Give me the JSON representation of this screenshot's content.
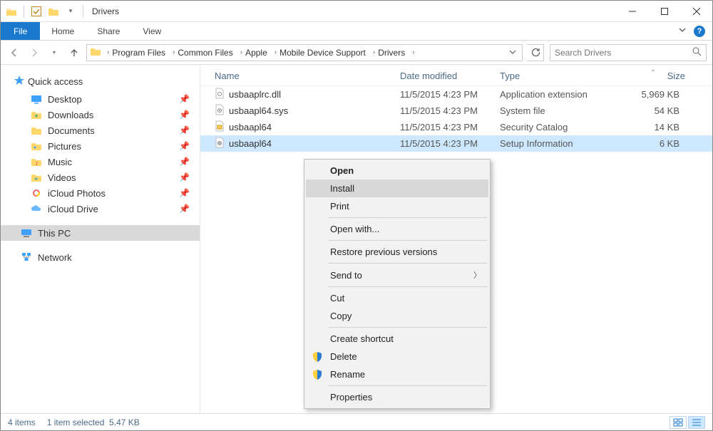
{
  "window": {
    "title": "Drivers"
  },
  "ribbon": {
    "file": "File",
    "tabs": [
      "Home",
      "Share",
      "View"
    ]
  },
  "breadcrumbs": [
    "Program Files",
    "Common Files",
    "Apple",
    "Mobile Device Support",
    "Drivers"
  ],
  "search": {
    "placeholder": "Search Drivers"
  },
  "sidebar": {
    "quick_access": "Quick access",
    "items": [
      {
        "label": "Desktop",
        "icon": "desktop"
      },
      {
        "label": "Downloads",
        "icon": "downloads"
      },
      {
        "label": "Documents",
        "icon": "documents"
      },
      {
        "label": "Pictures",
        "icon": "pictures"
      },
      {
        "label": "Music",
        "icon": "music"
      },
      {
        "label": "Videos",
        "icon": "videos"
      },
      {
        "label": "iCloud Photos",
        "icon": "icloud-photos"
      },
      {
        "label": "iCloud Drive",
        "icon": "icloud-drive"
      }
    ],
    "this_pc": "This PC",
    "network": "Network"
  },
  "columns": {
    "name": "Name",
    "date": "Date modified",
    "type": "Type",
    "size": "Size"
  },
  "files": [
    {
      "name": "usbaaplrc.dll",
      "date": "11/5/2015 4:23 PM",
      "type": "Application extension",
      "size": "5,969 KB"
    },
    {
      "name": "usbaapl64.sys",
      "date": "11/5/2015 4:23 PM",
      "type": "System file",
      "size": "54 KB"
    },
    {
      "name": "usbaapl64",
      "date": "11/5/2015 4:23 PM",
      "type": "Security Catalog",
      "size": "14 KB"
    },
    {
      "name": "usbaapl64",
      "date": "11/5/2015 4:23 PM",
      "type": "Setup Information",
      "size": "6 KB"
    }
  ],
  "context_menu": {
    "open": "Open",
    "install": "Install",
    "print": "Print",
    "open_with": "Open with...",
    "restore": "Restore previous versions",
    "send_to": "Send to",
    "cut": "Cut",
    "copy": "Copy",
    "create_shortcut": "Create shortcut",
    "delete": "Delete",
    "rename": "Rename",
    "properties": "Properties"
  },
  "status": {
    "count": "4 items",
    "selection": "1 item selected",
    "sel_size": "5.47 KB"
  }
}
